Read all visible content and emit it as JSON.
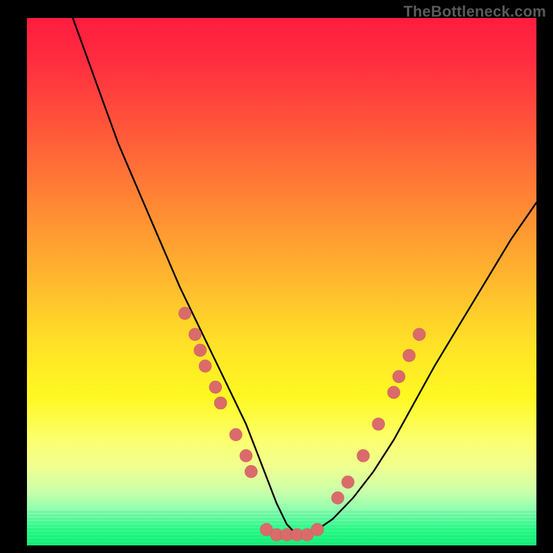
{
  "watermark": "TheBottleneck.com",
  "colors": {
    "gradient_top": "#ff1c3f",
    "gradient_bottom": "#16f47a",
    "curve": "#000000",
    "dots": "#db6b6b",
    "frame": "#000000"
  },
  "chart_data": {
    "type": "line",
    "title": "",
    "xlabel": "",
    "ylabel": "",
    "xlim": [
      0,
      100
    ],
    "ylim": [
      0,
      100
    ],
    "grid": false,
    "legend": false,
    "series": [
      {
        "name": "bottleneck-curve",
        "x": [
          9,
          12,
          15,
          18,
          22,
          26,
          30,
          34,
          37,
          40,
          43,
          45,
          47,
          49,
          51,
          53,
          55,
          57,
          60,
          64,
          68,
          72,
          76,
          80,
          85,
          90,
          95,
          100
        ],
        "y": [
          100,
          92,
          84,
          76,
          67,
          58,
          49,
          41,
          35,
          29,
          23,
          18,
          13,
          8,
          4,
          2,
          2,
          3,
          5,
          9,
          14,
          20,
          27,
          34,
          42,
          50,
          58,
          65
        ]
      }
    ],
    "points": [
      {
        "name": "left-cluster",
        "x": 31,
        "y": 44
      },
      {
        "name": "left-cluster",
        "x": 33,
        "y": 40
      },
      {
        "name": "left-cluster",
        "x": 34,
        "y": 37
      },
      {
        "name": "left-cluster",
        "x": 35,
        "y": 34
      },
      {
        "name": "left-cluster",
        "x": 37,
        "y": 30
      },
      {
        "name": "left-cluster",
        "x": 38,
        "y": 27
      },
      {
        "name": "left-cluster",
        "x": 41,
        "y": 21
      },
      {
        "name": "left-cluster",
        "x": 43,
        "y": 17
      },
      {
        "name": "left-cluster",
        "x": 44,
        "y": 14
      },
      {
        "name": "bottom-flat",
        "x": 47,
        "y": 3
      },
      {
        "name": "bottom-flat",
        "x": 49,
        "y": 2
      },
      {
        "name": "bottom-flat",
        "x": 51,
        "y": 2
      },
      {
        "name": "bottom-flat",
        "x": 53,
        "y": 2
      },
      {
        "name": "bottom-flat",
        "x": 55,
        "y": 2
      },
      {
        "name": "bottom-flat",
        "x": 57,
        "y": 3
      },
      {
        "name": "right-cluster",
        "x": 61,
        "y": 9
      },
      {
        "name": "right-cluster",
        "x": 63,
        "y": 12
      },
      {
        "name": "right-cluster",
        "x": 66,
        "y": 17
      },
      {
        "name": "right-cluster",
        "x": 69,
        "y": 23
      },
      {
        "name": "right-cluster",
        "x": 72,
        "y": 29
      },
      {
        "name": "right-cluster",
        "x": 73,
        "y": 32
      },
      {
        "name": "right-cluster",
        "x": 75,
        "y": 36
      },
      {
        "name": "right-cluster",
        "x": 77,
        "y": 40
      }
    ]
  }
}
